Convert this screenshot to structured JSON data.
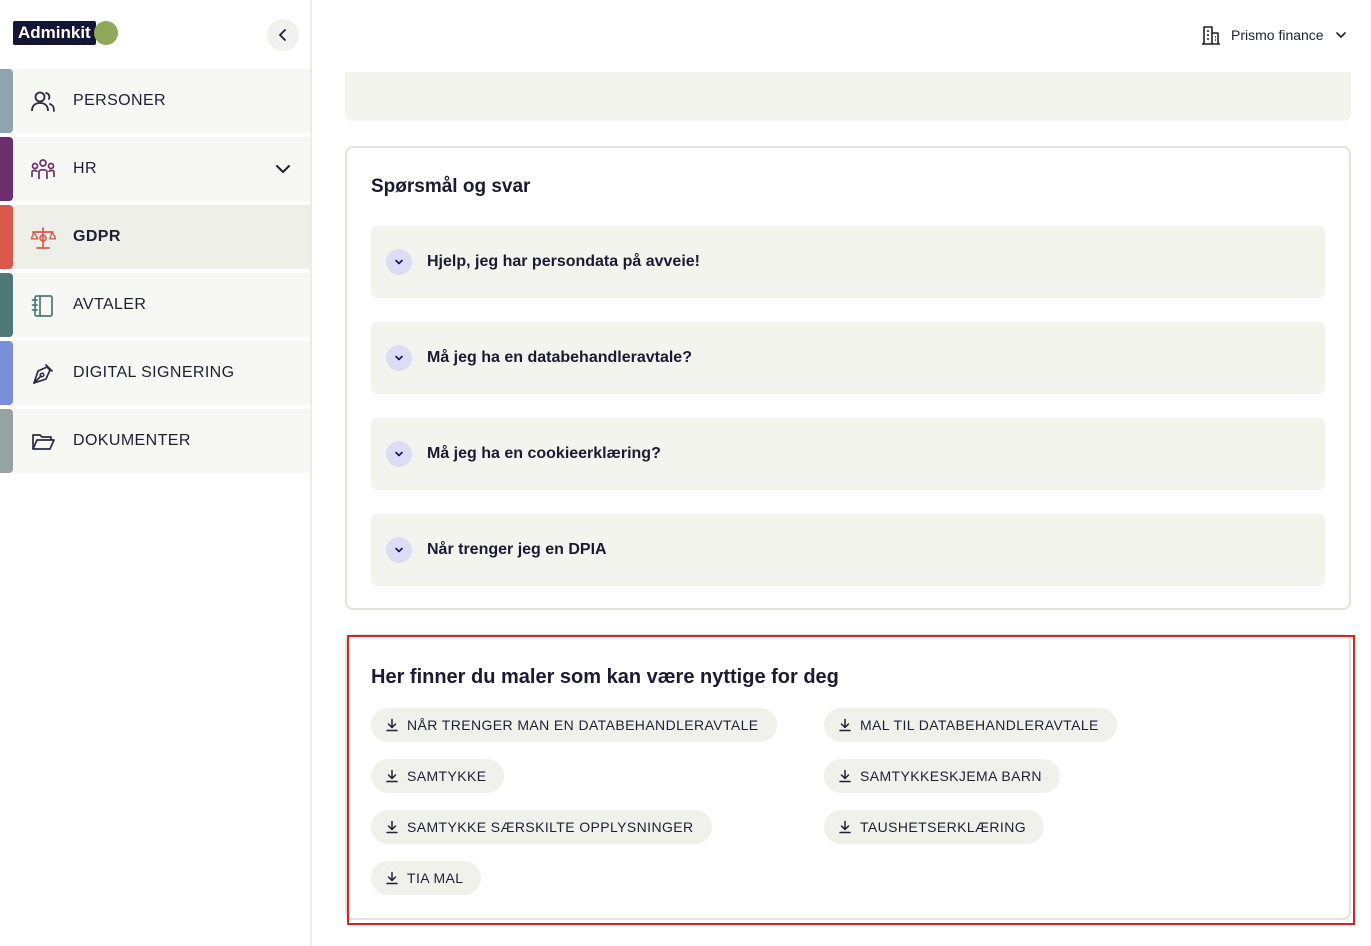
{
  "brand": {
    "logo_text": "Adminkit"
  },
  "header": {
    "company_name": "Prismo finance"
  },
  "sidebar": {
    "items": [
      {
        "label": "PERSONER",
        "icon": "users-icon",
        "color": "#8fa3b0"
      },
      {
        "label": "HR",
        "icon": "team-icon",
        "color": "#6b2f6e",
        "expandable": true
      },
      {
        "label": "GDPR",
        "icon": "scale-icon",
        "color": "#d95a4a",
        "active": true
      },
      {
        "label": "AVTALER",
        "icon": "notebook-icon",
        "color": "#4f7878"
      },
      {
        "label": "DIGITAL SIGNERING",
        "icon": "pen-icon",
        "color": "#7b8fd9"
      },
      {
        "label": "DOKUMENTER",
        "icon": "folder-icon",
        "color": "#95a3a3"
      }
    ]
  },
  "faq": {
    "title": "Spørsmål og svar",
    "items": [
      "Hjelp, jeg har persondata på avveie!",
      "Må jeg ha en databehandleravtale?",
      "Må jeg ha en cookieerklæring?",
      "Når trenger jeg en DPIA"
    ]
  },
  "templates": {
    "title": "Her finner du maler som kan være nyttige for deg",
    "items": [
      "NÅR TRENGER MAN EN DATABEHANDLERAVTALE",
      "MAL TIL DATABEHANDLERAVTALE",
      "SAMTYKKE",
      "SAMTYKKESKJEMA BARN",
      "SAMTYKKE SÆRSKILTE OPPLYSNINGER",
      "TAUSHETSERKLÆRING",
      "TIA MAL"
    ]
  },
  "colors": {
    "accent_highlight": "#e0201c",
    "card_bg": "#f4f4ef",
    "brand_dark": "#141436"
  }
}
